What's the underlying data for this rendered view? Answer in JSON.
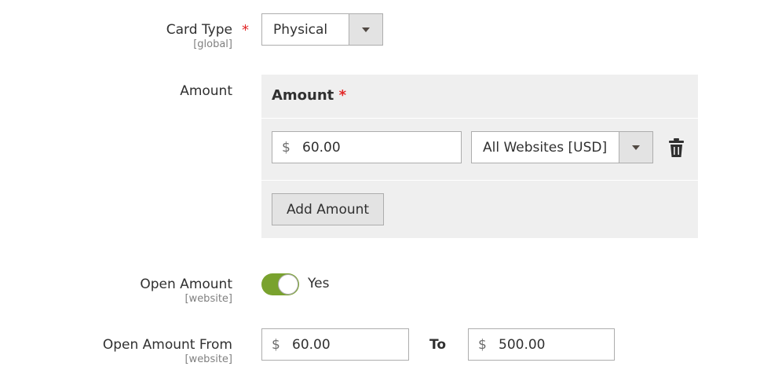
{
  "card_type": {
    "label": "Card Type",
    "required_mark": "*",
    "scope": "[global]",
    "selected": "Physical"
  },
  "amount": {
    "label": "Amount",
    "panel_title": "Amount",
    "required_mark": "*",
    "rows": [
      {
        "currency_symbol": "$",
        "value": "60.00",
        "website": "All Websites [USD]"
      }
    ],
    "add_button": "Add Amount"
  },
  "open_amount": {
    "label": "Open Amount",
    "scope": "[website]",
    "toggle_on": true,
    "toggle_text": "Yes"
  },
  "open_amount_from": {
    "label": "Open Amount From",
    "scope": "[website]",
    "from_symbol": "$",
    "from_value": "60.00",
    "to_label": "To",
    "to_symbol": "$",
    "to_value": "500.00"
  },
  "colors": {
    "toggle_on": "#79a22e",
    "required": "#e22626",
    "panel_bg": "#efefef"
  }
}
